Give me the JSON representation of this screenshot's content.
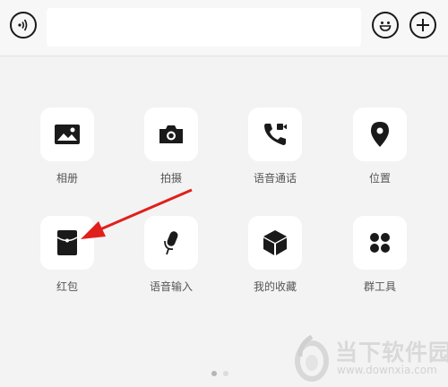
{
  "input_bar": {
    "voice_icon": "voice-wave-icon",
    "message_value": "",
    "emoji_icon": "smiley-face-icon",
    "plus_icon": "plus-icon"
  },
  "tools": [
    {
      "label": "相册",
      "icon": "image-icon"
    },
    {
      "label": "拍摄",
      "icon": "camera-icon"
    },
    {
      "label": "语音通话",
      "icon": "phone-video-icon"
    },
    {
      "label": "位置",
      "icon": "location-pin-icon"
    },
    {
      "label": "红包",
      "icon": "red-packet-icon"
    },
    {
      "label": "语音输入",
      "icon": "microphone-icon"
    },
    {
      "label": "我的收藏",
      "icon": "cube-icon"
    },
    {
      "label": "群工具",
      "icon": "grid-dots-icon"
    }
  ],
  "page_indicator": {
    "pages": 2,
    "current": 1
  },
  "annotation": {
    "color": "#e0201c",
    "icon": "red-arrow-icon"
  },
  "watermark": {
    "title": "当下软件园",
    "url": "www.downxia.com"
  },
  "colors": {
    "icon": "#1a1a1a",
    "tile": "#ffffff",
    "background": "#f3f3f3",
    "label": "#555555"
  }
}
